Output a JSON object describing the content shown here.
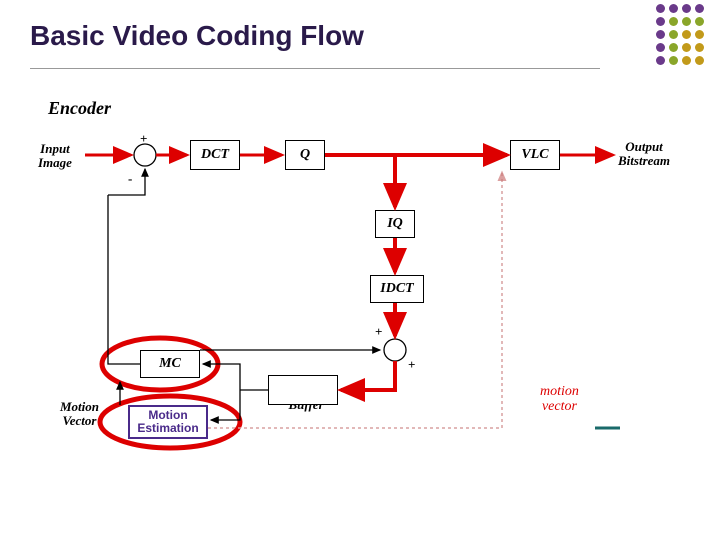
{
  "title": "Basic Video Coding Flow",
  "section": "Encoder",
  "labels": {
    "input": "Input\nImage",
    "output": "Output\nBitstream",
    "mv_left": "Motion\nVector",
    "frame_buf": "Frame\nBuffer",
    "mv_right": "motion\nvector",
    "plus_tl": "+",
    "minus_tl": "-",
    "plus_br1": "+",
    "plus_br2": "+"
  },
  "blocks": {
    "dct": "DCT",
    "q": "Q",
    "vlc": "VLC",
    "iq": "IQ",
    "idct": "IDCT",
    "mc": "MC",
    "me": "Motion\nEstimation",
    "fb": ""
  }
}
